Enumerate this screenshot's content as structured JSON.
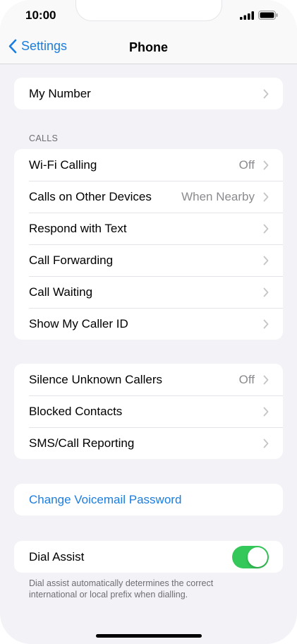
{
  "status_bar": {
    "time": "10:00"
  },
  "nav": {
    "back_label": "Settings",
    "title": "Phone"
  },
  "group_my_number": {
    "items": [
      {
        "label": "My Number"
      }
    ]
  },
  "calls_section": {
    "header": "CALLS",
    "items": [
      {
        "label": "Wi-Fi Calling",
        "value": "Off"
      },
      {
        "label": "Calls on Other Devices",
        "value": "When Nearby"
      },
      {
        "label": "Respond with Text"
      },
      {
        "label": "Call Forwarding"
      },
      {
        "label": "Call Waiting"
      },
      {
        "label": "Show My Caller ID"
      }
    ]
  },
  "privacy_section": {
    "items": [
      {
        "label": "Silence Unknown Callers",
        "value": "Off"
      },
      {
        "label": "Blocked Contacts"
      },
      {
        "label": "SMS/Call Reporting"
      }
    ]
  },
  "voicemail_section": {
    "link_label": "Change Voicemail Password"
  },
  "dial_assist": {
    "label": "Dial Assist",
    "enabled": true,
    "footer_line1": "Dial assist automatically determines the correct",
    "footer_line2": "international or local prefix when dialling."
  },
  "colors": {
    "accent": "#1a7ddf",
    "toggle_on": "#34c759",
    "background": "#f2f2f7"
  }
}
